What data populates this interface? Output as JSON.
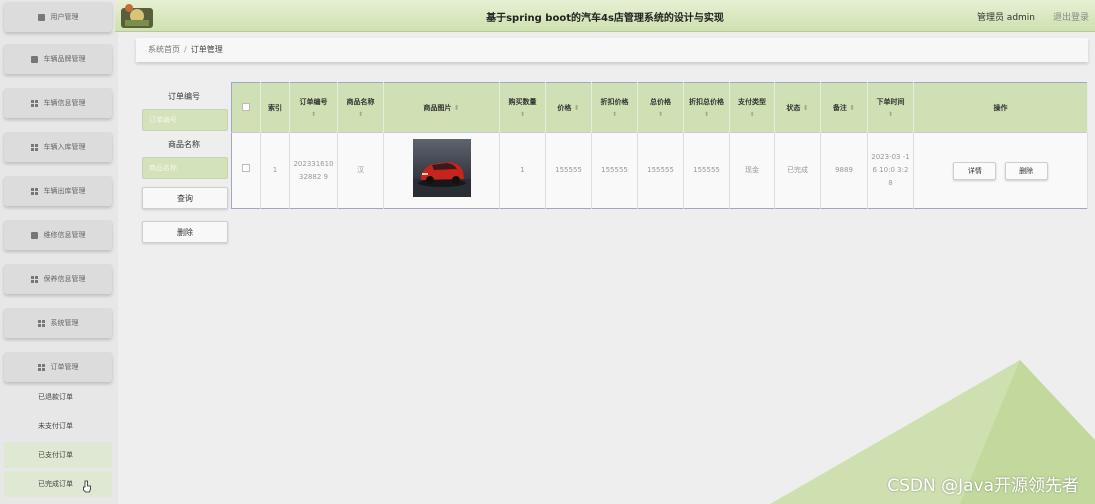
{
  "header": {
    "title": "基于spring boot的汽车4s店管理系统的设计与实现",
    "user": "管理员 admin",
    "logout": "退出登录"
  },
  "sidebar": {
    "items": [
      {
        "label": "用户管理",
        "icon": "doc-icon"
      },
      {
        "label": "车辆品牌管理",
        "icon": "doc-icon"
      },
      {
        "label": "车辆信息管理",
        "icon": "grid-icon"
      },
      {
        "label": "车辆入库管理",
        "icon": "grid-icon"
      },
      {
        "label": "车辆出库管理",
        "icon": "grid-icon"
      },
      {
        "label": "维修信息管理",
        "icon": "doc-icon"
      },
      {
        "label": "保养信息管理",
        "icon": "grid-icon"
      },
      {
        "label": "系统管理",
        "icon": "grid-icon"
      },
      {
        "label": "订单管理",
        "icon": "grid-icon"
      }
    ],
    "sub_items": [
      "已退款订单",
      "未支付订单",
      "已支付订单",
      "已完成订单"
    ]
  },
  "breadcrumb": {
    "home": "系统首页",
    "separator": "/",
    "current": "订单管理"
  },
  "search": {
    "order_no_label": "订单编号",
    "order_no_placeholder": "订单编号",
    "product_label": "商品名称",
    "product_placeholder": "商品名称",
    "query_button": "查询",
    "delete_button": "删除"
  },
  "table": {
    "columns": [
      "索引",
      "订单编号",
      "商品名称",
      "商品图片",
      "购买数量",
      "价格",
      "折扣价格",
      "总价格",
      "折扣总价格",
      "支付类型",
      "状态",
      "备注",
      "下单时间",
      "操作"
    ],
    "rows": [
      {
        "index": "1",
        "order_no": "20233161032882 9",
        "product": "汉",
        "quantity": "1",
        "price": "155555",
        "discount_price": "155555",
        "total": "155555",
        "discount_total": "155555",
        "pay_type": "现金",
        "status": "已完成",
        "note": "9889",
        "time": "2023-03 -16 10:0 3:28"
      }
    ],
    "detail_button": "详情",
    "delete_button": "删除"
  },
  "watermark": "CSDN @Java开源领先者",
  "colors": {
    "accent": "#cfe0b4",
    "header": "#d8e7bf",
    "triangle": "#c8dca3"
  }
}
